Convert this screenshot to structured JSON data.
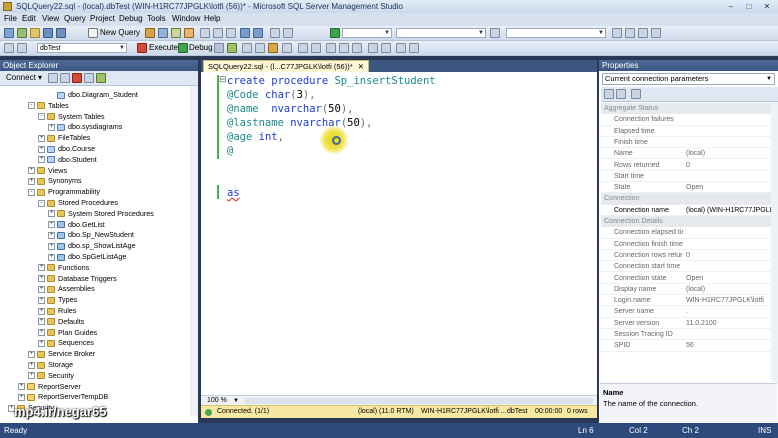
{
  "window": {
    "title": "SQLQuery22.sql - (local).dbTest (WIN-H1RC77JPGLK\\lotfi (56))* - Microsoft SQL Server Management Studio",
    "min": "–",
    "max": "□",
    "close": "✕"
  },
  "menu": [
    "File",
    "Edit",
    "View",
    "Query",
    "Project",
    "Debug",
    "Tools",
    "Window",
    "Help"
  ],
  "toolbar1": {
    "new_query": "New Query"
  },
  "toolbar2": {
    "database": "dbTest",
    "execute": "Execute",
    "debug": "Debug"
  },
  "object_explorer": {
    "title": "Object Explorer",
    "connect": "Connect ▾",
    "tree": [
      {
        "label": "dbo.Diagram_Student",
        "level": 6,
        "exp": "",
        "icon": "table"
      },
      {
        "label": "Tables",
        "level": 4,
        "exp": "-",
        "icon": "folder"
      },
      {
        "label": "System Tables",
        "level": 5,
        "exp": "-",
        "icon": "folder"
      },
      {
        "label": "dbo.sysdiagrams",
        "level": 6,
        "exp": "+",
        "icon": "table"
      },
      {
        "label": "FileTables",
        "level": 5,
        "exp": "+",
        "icon": "folder"
      },
      {
        "label": "dbo.Course",
        "level": 5,
        "exp": "+",
        "icon": "table"
      },
      {
        "label": "dbo.Student",
        "level": 5,
        "exp": "+",
        "icon": "table"
      },
      {
        "label": "Views",
        "level": 4,
        "exp": "+",
        "icon": "folder"
      },
      {
        "label": "Synonyms",
        "level": 4,
        "exp": "+",
        "icon": "folder"
      },
      {
        "label": "Programmability",
        "level": 4,
        "exp": "-",
        "icon": "folder"
      },
      {
        "label": "Stored Procedures",
        "level": 5,
        "exp": "-",
        "icon": "folder"
      },
      {
        "label": "System Stored Procedures",
        "level": 6,
        "exp": "+",
        "icon": "folder"
      },
      {
        "label": "dbo.GetList",
        "level": 6,
        "exp": "+",
        "icon": "proc"
      },
      {
        "label": "dbo.Sp_NewStudent",
        "level": 6,
        "exp": "+",
        "icon": "proc"
      },
      {
        "label": "dbo.sp_ShowListAge",
        "level": 6,
        "exp": "+",
        "icon": "proc"
      },
      {
        "label": "dbo.SpGetListAge",
        "level": 6,
        "exp": "+",
        "icon": "proc"
      },
      {
        "label": "Functions",
        "level": 5,
        "exp": "+",
        "icon": "folder"
      },
      {
        "label": "Database Triggers",
        "level": 5,
        "exp": "+",
        "icon": "folder"
      },
      {
        "label": "Assemblies",
        "level": 5,
        "exp": "+",
        "icon": "folder"
      },
      {
        "label": "Types",
        "level": 5,
        "exp": "+",
        "icon": "folder"
      },
      {
        "label": "Rules",
        "level": 5,
        "exp": "+",
        "icon": "folder"
      },
      {
        "label": "Defaults",
        "level": 5,
        "exp": "+",
        "icon": "folder"
      },
      {
        "label": "Plan Guides",
        "level": 5,
        "exp": "+",
        "icon": "folder"
      },
      {
        "label": "Sequences",
        "level": 5,
        "exp": "+",
        "icon": "folder"
      },
      {
        "label": "Service Broker",
        "level": 4,
        "exp": "+",
        "icon": "folder"
      },
      {
        "label": "Storage",
        "level": 4,
        "exp": "+",
        "icon": "folder"
      },
      {
        "label": "Security",
        "level": 4,
        "exp": "+",
        "icon": "folder"
      },
      {
        "label": "ReportServer",
        "level": 3,
        "exp": "+",
        "icon": "db"
      },
      {
        "label": "ReportServerTempDB",
        "level": 3,
        "exp": "+",
        "icon": "db"
      },
      {
        "label": "Security",
        "level": 2,
        "exp": "+",
        "icon": "folder"
      }
    ]
  },
  "editor": {
    "tab": "SQLQuery22.sql - (l...C77JPGLK\\lotfi (56))*",
    "tab_close": "✕",
    "zoom": "100 %",
    "status_connected": "Connected. (1/1)",
    "status_server": "(local) (11.0 RTM)",
    "status_login": "WIN-H1RC77JPGLK\\lotfi ...",
    "status_db": "dbTest",
    "status_time": "00:00:00",
    "status_rows": "0 rows"
  },
  "properties": {
    "title": "Properties",
    "object": "Current connection parameters",
    "rows": [
      {
        "type": "cat",
        "label": "Aggregate Status"
      },
      {
        "type": "row",
        "k": "Connection failures",
        "v": ""
      },
      {
        "type": "row",
        "k": "Elapsed time",
        "v": ""
      },
      {
        "type": "row",
        "k": "Finish time",
        "v": ""
      },
      {
        "type": "row",
        "k": "Name",
        "v": "(local)"
      },
      {
        "type": "row",
        "k": "Rows returned",
        "v": "0"
      },
      {
        "type": "row",
        "k": "Start time",
        "v": ""
      },
      {
        "type": "row",
        "k": "State",
        "v": "Open"
      },
      {
        "type": "cat",
        "label": "Connection"
      },
      {
        "type": "row",
        "k": "Connection name",
        "v": "(local) (WIN-H1RC77JPGLK\\lo",
        "active": true
      },
      {
        "type": "cat",
        "label": "Connection Details"
      },
      {
        "type": "row",
        "k": "Connection elapsed tir",
        "v": ""
      },
      {
        "type": "row",
        "k": "Connection finish time",
        "v": ""
      },
      {
        "type": "row",
        "k": "Connection rows retur",
        "v": "0"
      },
      {
        "type": "row",
        "k": "Connection start time",
        "v": ""
      },
      {
        "type": "row",
        "k": "Connection state",
        "v": "Open"
      },
      {
        "type": "row",
        "k": "Display name",
        "v": "(local)"
      },
      {
        "type": "row",
        "k": "Login name",
        "v": "WIN-H1RC77JPGLK\\lotfi"
      },
      {
        "type": "row",
        "k": "Server name",
        "v": "."
      },
      {
        "type": "row",
        "k": "Server version",
        "v": "11.0.2100"
      },
      {
        "type": "row",
        "k": "Session Tracing ID",
        "v": ""
      },
      {
        "type": "row",
        "k": "SPID",
        "v": "56"
      }
    ],
    "desc_title": "Name",
    "desc_text": "The name of the connection."
  },
  "statusbar": {
    "ready": "Ready",
    "ln": "Ln 6",
    "col": "Col 2",
    "ch": "Ch 2",
    "ins": "INS"
  },
  "watermark": "mp4.ir/negar65"
}
